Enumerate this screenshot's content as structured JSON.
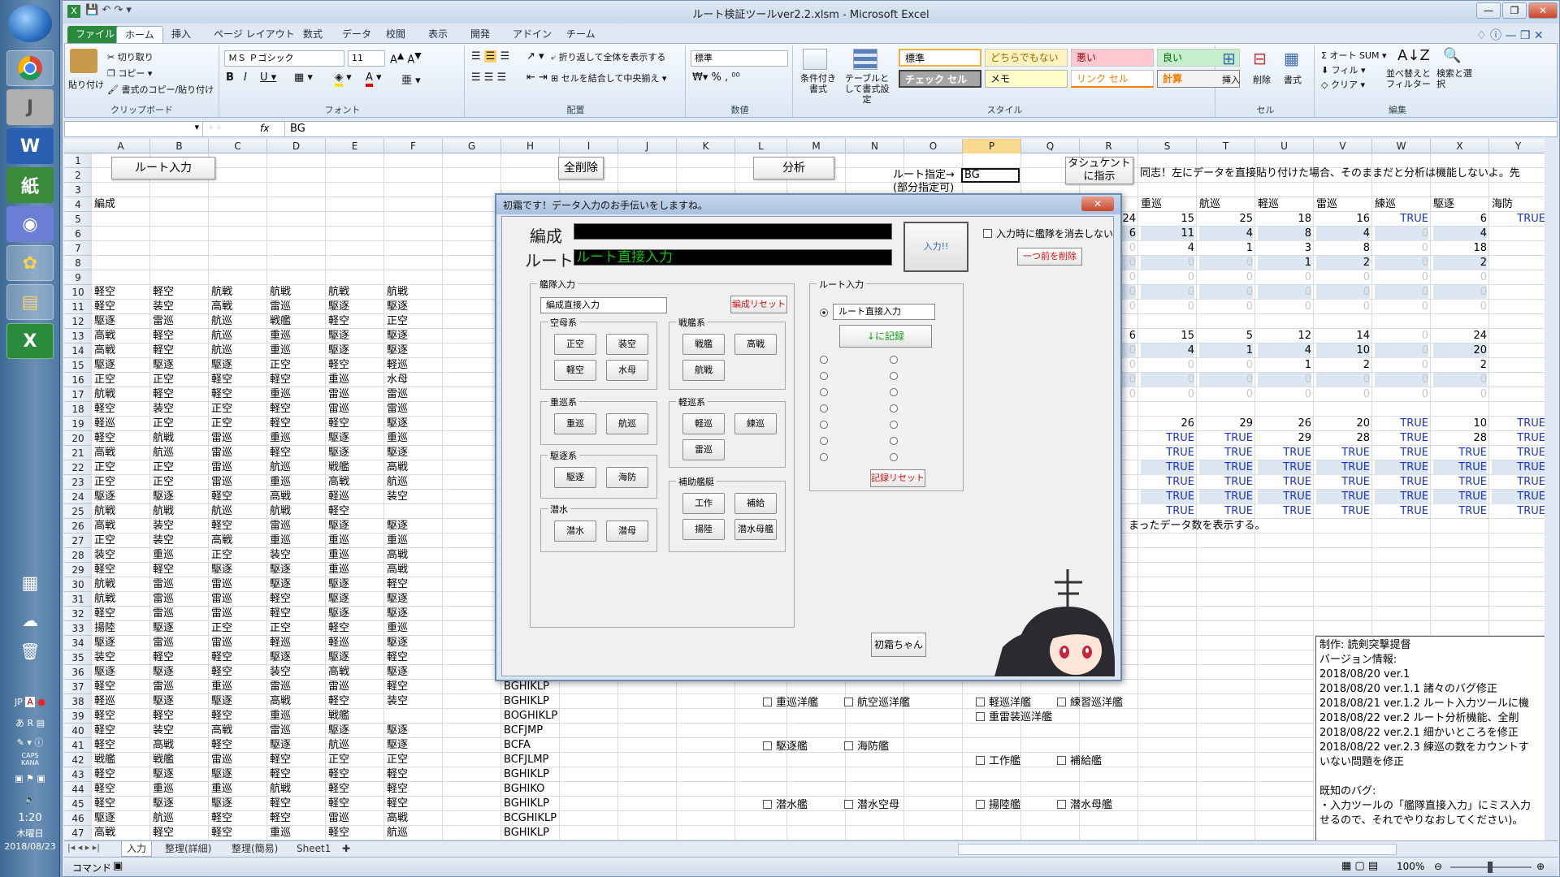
{
  "window_title": "ルート検証ツールver2.2.xlsm - Microsoft Excel",
  "ribbon_tabs": [
    "ファイル",
    "ホーム",
    "挿入",
    "ページ レイアウト",
    "数式",
    "データ",
    "校閲",
    "表示",
    "開発",
    "アドイン",
    "チーム"
  ],
  "ribbon": {
    "clipboard": {
      "paste": "貼り付け",
      "cut": "切り取り",
      "copy": "コピー",
      "format_painter": "書式のコピー/貼り付け",
      "label": "クリップボード"
    },
    "font": {
      "name": "ＭＳ Ｐゴシック",
      "size": "11",
      "label": "フォント"
    },
    "alignment": {
      "wrap": "折り返して全体を表示する",
      "merge": "セルを結合して中央揃え",
      "label": "配置"
    },
    "number": {
      "format": "標準",
      "label": "数値"
    },
    "styles": {
      "conditional": "条件付き書式",
      "table": "テーブルとして書式設定",
      "label": "スタイル",
      "cells": [
        "標準",
        "どちらでもない",
        "悪い",
        "良い",
        "チェック セル",
        "メモ",
        "リンク セル",
        "計算"
      ]
    },
    "cells": {
      "insert": "挿入",
      "delete": "削除",
      "format": "書式",
      "label": "セル"
    },
    "editing": {
      "autosum": "オート SUM",
      "fill": "フィル",
      "clear": "クリア",
      "sort": "並べ替えとフィルター",
      "find": "検索と選択",
      "label": "編集"
    }
  },
  "formula_bar": {
    "fx": "fx",
    "value": "BG"
  },
  "columns": [
    "A",
    "B",
    "C",
    "D",
    "E",
    "F",
    "G",
    "H",
    "I",
    "J",
    "K",
    "L",
    "M",
    "N",
    "O",
    "P",
    "Q",
    "R",
    "S",
    "T",
    "U",
    "V",
    "W",
    "X",
    "Y"
  ],
  "sheet": {
    "btn_route_input": "ルート入力",
    "btn_clear_all": "全削除",
    "btn_analyze": "分析",
    "route_spec_label": "ルート指定→",
    "partial_spec": "(部分指定可)",
    "route_spec_value": "BG",
    "btn_tashkent": "タシュケント",
    "btn_tashkent2": "に指示",
    "note_top": "同志！左にデータを直接貼り付けた場合、そのままだと分析は機能しないよ。先",
    "header_fleet": "編成",
    "summary_headers": [
      "重巡",
      "航巡",
      "軽巡",
      "雷巡",
      "練巡",
      "駆逐",
      "海防"
    ],
    "summary_rows": [
      [
        "24",
        "15",
        "25",
        "18",
        "16",
        "TRUE",
        "6",
        "TRUE"
      ],
      [
        "6",
        "11",
        "4",
        "8",
        "4",
        "0",
        "4",
        ""
      ],
      [
        "0",
        "4",
        "1",
        "3",
        "8",
        "0",
        "18",
        ""
      ],
      [
        "0",
        "0",
        "0",
        "1",
        "2",
        "0",
        "2",
        ""
      ],
      [
        "0",
        "0",
        "0",
        "0",
        "0",
        "0",
        "0",
        ""
      ],
      [
        "0",
        "0",
        "0",
        "0",
        "0",
        "0",
        "0",
        ""
      ],
      [
        "0",
        "0",
        "0",
        "0",
        "0",
        "0",
        "0",
        ""
      ]
    ],
    "summary2_rows": [
      [
        "6",
        "15",
        "5",
        "12",
        "14",
        "0",
        "24",
        ""
      ],
      [
        "0",
        "4",
        "1",
        "4",
        "10",
        "0",
        "20",
        ""
      ],
      [
        "0",
        "0",
        "0",
        "1",
        "2",
        "0",
        "2",
        ""
      ],
      [
        "0",
        "0",
        "0",
        "0",
        "0",
        "0",
        "0",
        ""
      ],
      [
        "0",
        "0",
        "0",
        "0",
        "0",
        "0",
        "0",
        ""
      ]
    ],
    "true_rows_top": [
      "",
      "26",
      "29",
      "26",
      "20",
      "TRUE",
      "10",
      "TRUE"
    ],
    "true_row20": [
      "",
      "TRUE",
      "TRUE",
      "29",
      "28",
      "TRUE",
      "28",
      "TRUE"
    ],
    "true_word": "TRUE",
    "note_row26": "まったデータ数を表示する。",
    "fleet_rows": [
      [
        "軽空",
        "軽空",
        "航戦",
        "航戦",
        "航戦",
        "航戦"
      ],
      [
        "軽空",
        "装空",
        "高戦",
        "雷巡",
        "駆逐",
        "駆逐"
      ],
      [
        "駆逐",
        "雷巡",
        "航巡",
        "戦艦",
        "軽空",
        "正空"
      ],
      [
        "高戦",
        "軽空",
        "航巡",
        "重巡",
        "駆逐",
        "駆逐"
      ],
      [
        "高戦",
        "軽空",
        "航巡",
        "重巡",
        "駆逐",
        "駆逐"
      ],
      [
        "駆逐",
        "駆逐",
        "駆逐",
        "正空",
        "軽空",
        "軽巡"
      ],
      [
        "正空",
        "正空",
        "軽空",
        "軽空",
        "重巡",
        "水母"
      ],
      [
        "航戦",
        "軽空",
        "軽空",
        "重巡",
        "雷巡",
        "雷巡"
      ],
      [
        "軽空",
        "装空",
        "正空",
        "軽空",
        "雷巡",
        "雷巡"
      ],
      [
        "軽巡",
        "正空",
        "正空",
        "軽空",
        "軽空",
        "駆逐"
      ],
      [
        "軽空",
        "航戦",
        "雷巡",
        "重巡",
        "駆逐",
        "重巡"
      ],
      [
        "高戦",
        "航巡",
        "雷巡",
        "軽空",
        "駆逐",
        "駆逐"
      ],
      [
        "正空",
        "正空",
        "雷巡",
        "航巡",
        "戦艦",
        "高戦"
      ],
      [
        "正空",
        "正空",
        "雷巡",
        "重巡",
        "高戦",
        "航巡"
      ],
      [
        "駆逐",
        "駆逐",
        "軽空",
        "高戦",
        "軽巡",
        "装空"
      ],
      [
        "航戦",
        "航戦",
        "航巡",
        "航戦",
        "軽空",
        ""
      ],
      [
        "高戦",
        "装空",
        "軽空",
        "雷巡",
        "駆逐",
        "駆逐"
      ],
      [
        "正空",
        "装空",
        "高戦",
        "重巡",
        "重巡",
        "重巡"
      ],
      [
        "装空",
        "重巡",
        "正空",
        "装空",
        "重巡",
        "高戦"
      ],
      [
        "軽空",
        "軽空",
        "駆逐",
        "駆逐",
        "重巡",
        "高戦"
      ],
      [
        "航戦",
        "雷巡",
        "雷巡",
        "駆逐",
        "駆逐",
        "軽空"
      ],
      [
        "航戦",
        "雷巡",
        "雷巡",
        "軽空",
        "駆逐",
        "駆逐"
      ],
      [
        "軽空",
        "雷巡",
        "雷巡",
        "軽空",
        "駆逐",
        "駆逐"
      ],
      [
        "揚陸",
        "駆逐",
        "正空",
        "正空",
        "軽空",
        "重巡"
      ],
      [
        "駆逐",
        "雷巡",
        "雷巡",
        "軽巡",
        "軽巡",
        "駆逐"
      ],
      [
        "装空",
        "軽空",
        "軽空",
        "駆逐",
        "駆逐",
        "軽空"
      ],
      [
        "駆逐",
        "駆逐",
        "軽空",
        "装空",
        "高戦",
        "駆逐"
      ],
      [
        "軽空",
        "雷巡",
        "重巡",
        "雷巡",
        "雷巡",
        "軽空"
      ],
      [
        "軽巡",
        "駆逐",
        "駆逐",
        "高戦",
        "軽空",
        "装空"
      ],
      [
        "軽空",
        "軽空",
        "軽空",
        "重巡",
        "戦艦",
        ""
      ],
      [
        "軽空",
        "装空",
        "高戦",
        "雷巡",
        "駆逐",
        "駆逐"
      ],
      [
        "軽空",
        "高戦",
        "軽空",
        "駆逐",
        "航巡",
        "駆逐"
      ],
      [
        "戦艦",
        "戦艦",
        "雷巡",
        "軽空",
        "正空",
        "正空"
      ],
      [
        "軽空",
        "駆逐",
        "駆逐",
        "軽空",
        "軽空",
        "軽空"
      ],
      [
        "軽空",
        "重巡",
        "重巡",
        "航戦",
        "軽空",
        "軽空"
      ],
      [
        "軽空",
        "駆逐",
        "駆逐",
        "軽空",
        "軽空",
        "軽空"
      ],
      [
        "駆逐",
        "航巡",
        "軽空",
        "軽空",
        "雷巡",
        "高戦"
      ],
      [
        "高戦",
        "軽空",
        "軽空",
        "重巡",
        "軽空",
        "航巡"
      ]
    ],
    "routes": [
      [
        "37",
        "BGHIKLP"
      ],
      [
        "38",
        "BGHIKLP"
      ],
      [
        "39",
        "BOGHIKLP"
      ],
      [
        "40",
        "BCFJMP"
      ],
      [
        "41",
        "BCFA"
      ],
      [
        "42",
        "BCFJLMP"
      ],
      [
        "43",
        "BGHIKLP"
      ],
      [
        "44",
        "BGHIKO"
      ],
      [
        "45",
        "BGHIKLP"
      ],
      [
        "46",
        "BCGHIKLP"
      ],
      [
        "47",
        "BGHIKLP"
      ]
    ],
    "checkboxes": [
      {
        "row": "38",
        "items": [
          "重巡洋艦",
          "航空巡洋艦",
          "軽巡洋艦",
          "練習巡洋艦"
        ]
      },
      {
        "row": "39",
        "items": [
          "重雷装巡洋艦"
        ]
      },
      {
        "row": "41",
        "items": [
          "駆逐艦",
          "海防艦"
        ]
      },
      {
        "row": "42",
        "items": [
          "工作艦",
          "補給艦"
        ]
      },
      {
        "row": "45",
        "items": [
          "潜水艦",
          "潜水空母",
          "揚陸艦",
          "潜水母艦"
        ]
      }
    ],
    "credits": [
      "制作: 読剣突撃提督",
      "バージョン情報:",
      "2018/08/20  ver.1",
      "2018/08/20  ver.1.1  諸々のバグ修正",
      "2018/08/21  ver.1.2  ルート入力ツールに機",
      "2018/08/22  ver.2    ルート分析機能、全削",
      "2018/08/22  ver.2.1  細かいところを修正",
      "2018/08/22  ver.2.3  練巡の数をカウントす",
      "いない問題を修正",
      "",
      "既知のバグ:",
      "・入力ツールの「艦隊直接入力」にミス入力",
      "せるので、それでやりなおしてください)。"
    ]
  },
  "sheet_tabs": [
    "入力",
    "整理(詳細)",
    "整理(簡易)",
    "Sheet1"
  ],
  "status": {
    "mode": "コマンド",
    "zoom": "100%"
  },
  "taskbar": {
    "ime": "JP",
    "clock_time": "1:20",
    "clock_day": "木曜日",
    "clock_date": "2018/08/23",
    "caps": "CAPS",
    "kana": "KANA"
  },
  "dialog": {
    "title": "初霜です！データ入力のお手伝いをしますね。",
    "fleet_label": "編成",
    "route_label": "ルート",
    "route_value": "ルート直接入力",
    "enter_btn": "入力!!",
    "keep_check": "入力時に艦隊を消去しない",
    "delete_prev": "一つ前を削除",
    "ship_frame": "艦隊入力",
    "fleet_direct": "編成直接入力",
    "fleet_reset": "編成リセット",
    "groups": [
      {
        "title": "空母系",
        "buttons": [
          "正空",
          "装空",
          "軽空",
          "水母"
        ]
      },
      {
        "title": "戦艦系",
        "buttons": [
          "戦艦",
          "高戦",
          "航戦"
        ]
      },
      {
        "title": "重巡系",
        "buttons": [
          "重巡",
          "航巡"
        ]
      },
      {
        "title": "軽巡系",
        "buttons": [
          "軽巡",
          "練巡",
          "雷巡"
        ]
      },
      {
        "title": "駆逐系",
        "buttons": [
          "駆逐",
          "海防"
        ]
      },
      {
        "title": "補助艦艇",
        "buttons": [
          "工作",
          "補給",
          "揚陸",
          "潜水母艦"
        ]
      },
      {
        "title": "潜水",
        "buttons": [
          "潜水",
          "潜母"
        ]
      }
    ],
    "route_frame": "ルート入力",
    "route_direct": "ルート直接入力",
    "record_btn": "↓に記録",
    "record_reset": "記録リセット",
    "hatsushimo_btn": "初霜ちゃん"
  },
  "colors": {
    "excel_green": "#2a8a3c",
    "dialog_green_text": "#12c012",
    "blue_true": "#1a33c9",
    "red_text": "#d21010"
  }
}
